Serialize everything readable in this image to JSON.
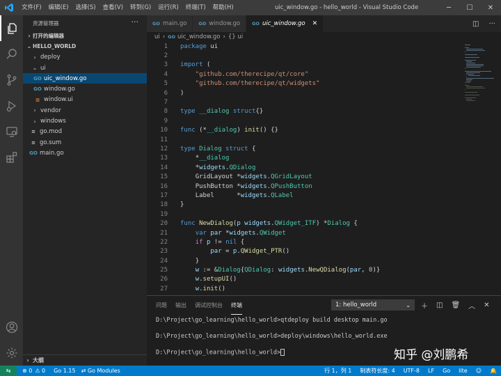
{
  "titlebar": {
    "menu": [
      "文件(F)",
      "编辑(E)",
      "选择(S)",
      "查看(V)",
      "转到(G)",
      "运行(R)",
      "终端(T)",
      "帮助(H)"
    ],
    "window_title": "uic_window.go - hello_world - Visual Studio Code"
  },
  "sidebar": {
    "header": "资源管理器",
    "open_editors": "打开的编辑器",
    "root": "HELLO_WORLD",
    "items": [
      {
        "label": "deploy",
        "type": "folder"
      },
      {
        "label": "ui",
        "type": "folder-open"
      },
      {
        "label": "uic_window.go",
        "type": "go"
      },
      {
        "label": "window.go",
        "type": "go"
      },
      {
        "label": "window.ui",
        "type": "ui"
      },
      {
        "label": "vendor",
        "type": "folder"
      },
      {
        "label": "windows",
        "type": "folder"
      },
      {
        "label": "go.mod",
        "type": "mod"
      },
      {
        "label": "go.sum",
        "type": "mod"
      },
      {
        "label": "main.go",
        "type": "go"
      }
    ],
    "outline": "大纲"
  },
  "tabs": [
    {
      "label": "main.go",
      "active": false
    },
    {
      "label": "window.go",
      "active": false
    },
    {
      "label": "uic_window.go",
      "active": true
    }
  ],
  "breadcrumb": {
    "folder": "ui",
    "file": "uic_window.go",
    "symbol": "{} ui"
  },
  "code_lines": [
    {
      "n": "1",
      "t": "package ui"
    },
    {
      "n": "2",
      "t": ""
    },
    {
      "n": "3",
      "t": "import ("
    },
    {
      "n": "4",
      "t": "    \"github.com/therecipe/qt/core\""
    },
    {
      "n": "5",
      "t": "    \"github.com/therecipe/qt/widgets\""
    },
    {
      "n": "6",
      "t": ")"
    },
    {
      "n": "7",
      "t": ""
    },
    {
      "n": "8",
      "t": "type __dialog struct{}"
    },
    {
      "n": "9",
      "t": ""
    },
    {
      "n": "10",
      "t": "func (*__dialog) init() {}"
    },
    {
      "n": "11",
      "t": ""
    },
    {
      "n": "12",
      "t": "type Dialog struct {"
    },
    {
      "n": "13",
      "t": "    *__dialog"
    },
    {
      "n": "14",
      "t": "    *widgets.QDialog"
    },
    {
      "n": "15",
      "t": "    GridLayout *widgets.QGridLayout"
    },
    {
      "n": "16",
      "t": "    PushButton *widgets.QPushButton"
    },
    {
      "n": "17",
      "t": "    Label      *widgets.QLabel"
    },
    {
      "n": "18",
      "t": "}"
    },
    {
      "n": "19",
      "t": ""
    },
    {
      "n": "20",
      "t": "func NewDialog(p widgets.QWidget_ITF) *Dialog {"
    },
    {
      "n": "21",
      "t": "    var par *widgets.QWidget"
    },
    {
      "n": "22",
      "t": "    if p != nil {"
    },
    {
      "n": "23",
      "t": "        par = p.QWidget_PTR()"
    },
    {
      "n": "24",
      "t": "    }"
    },
    {
      "n": "25",
      "t": "    w := &Dialog{QDialog: widgets.NewQDialog(par, 0)}"
    },
    {
      "n": "26",
      "t": "    w.setupUI()"
    },
    {
      "n": "27",
      "t": "    w.init()"
    }
  ],
  "panel": {
    "tabs": [
      "问题",
      "输出",
      "调试控制台",
      "终端"
    ],
    "active_tab": "终端",
    "terminal_select": "1: hello_world",
    "terminal_lines": [
      "D:\\Project\\go_learning\\hello_world>qtdeploy build desktop main.go",
      "D:\\Project\\go_learning\\hello_world>deploy\\windows\\hello_world.exe",
      "D:\\Project\\go_learning\\hello_world>"
    ],
    "watermark": "知乎 @刘鹏希"
  },
  "statusbar": {
    "errors": "⊗ 0",
    "warnings": "⚠ 0",
    "go_version": "Go 1.15",
    "go_modules": "Go Modules",
    "position": "行 1，列 1",
    "indent": "制表符长度: 4",
    "encoding": "UTF-8",
    "eol": "LF",
    "language": "Go",
    "lite": "lite"
  },
  "colors": {
    "accent": "#007acc",
    "selection": "#094771",
    "go_icon": "#519aba"
  }
}
